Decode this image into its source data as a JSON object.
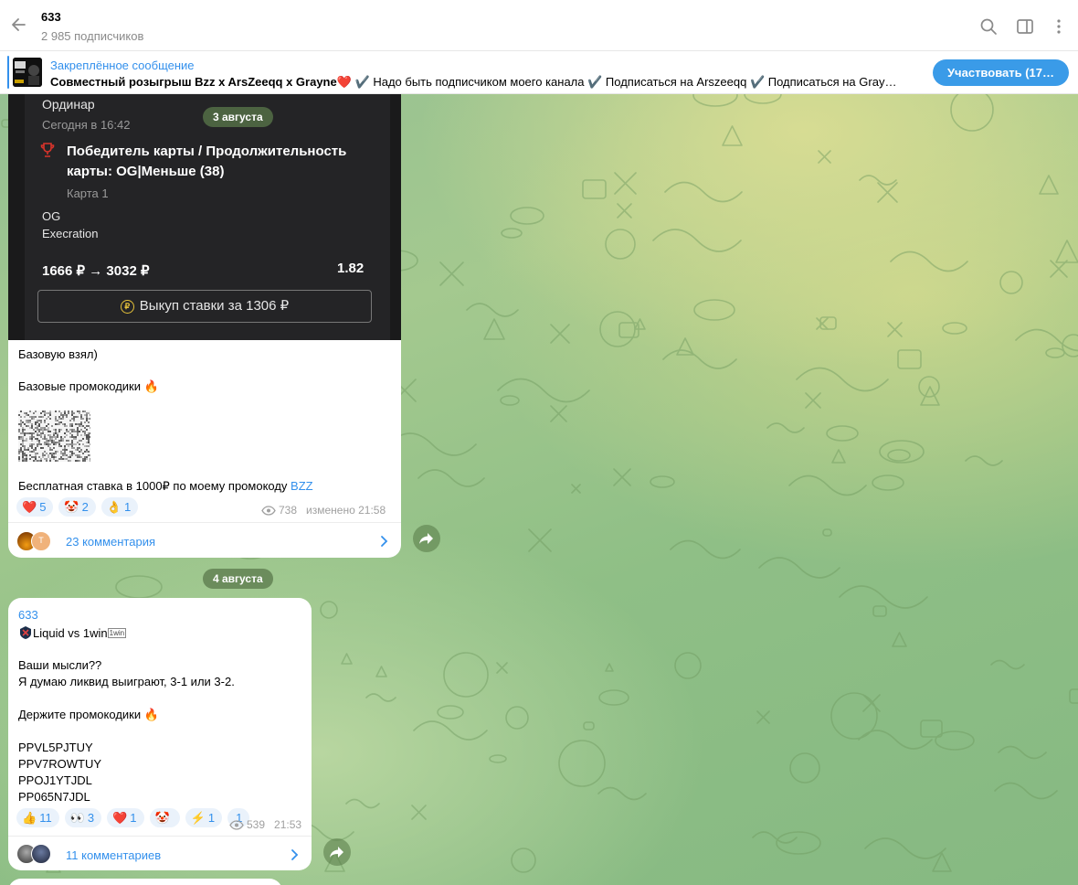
{
  "header": {
    "title": "633",
    "subscribers": "2 985 подписчиков"
  },
  "pinned": {
    "title": "Закреплённое сообщение",
    "text_bold": "Совместный розыгрыш Bzz x ArsZeeqq x Grayne",
    "text_rest": "❤️ ✔️ Надо быть подписчиком моего канала ✔️ Подписаться на Arszeeqq ✔️ Подписаться на Gray…",
    "button": "Участвовать (17…"
  },
  "message1": {
    "date_pill": "3 августа",
    "bet": {
      "type": "Ординар",
      "time": "Сегодня в 16:42",
      "market": "Победитель карты / Продолжительность карты: OG|Меньше (38)",
      "map": "Карта 1",
      "team1": "OG",
      "team2": "Execration",
      "amount": "1666 ₽ → 3032 ₽",
      "coefficient": "1.82",
      "buyout": "Выкуп ставки за 1306 ₽"
    },
    "line1": "Базовую взял)",
    "line2": "Базовые промокодики 🔥",
    "promo_text": "Бесплатная ставка в 1000₽ по моему промокоду ",
    "promo_code": "BZZ",
    "reactions": [
      {
        "emoji": "❤️",
        "count": "5"
      },
      {
        "emoji": "🤡",
        "count": "2"
      },
      {
        "emoji": "👌",
        "count": "1"
      }
    ],
    "views": "738",
    "edited": "изменено 21:58",
    "comments": "23 комментария"
  },
  "date2": "4 августа",
  "message2": {
    "author": "633",
    "title": "Liquid vs 1win",
    "badge": "1win",
    "line1": "Ваши мысли??",
    "line2": "Я думаю ликвид выиграют, 3-1 или 3-2.",
    "line3": "Держите промокодики 🔥",
    "codes": [
      "PPVL5PJTUY",
      "PPV7ROWTUY",
      "PPOJ1YTJDL",
      "PP065N7JDL"
    ],
    "reactions": [
      {
        "emoji": "👍",
        "count": "11"
      },
      {
        "emoji": "👀",
        "count": "3"
      },
      {
        "emoji": "❤️",
        "count": "1"
      },
      {
        "emoji": "🤡",
        "count": ""
      },
      {
        "emoji": "⚡",
        "count": "1"
      },
      {
        "emoji": "",
        "count": "1"
      }
    ],
    "views": "539",
    "time": "21:53",
    "comments": "11 комментариев"
  },
  "colors": {
    "accent": "#3390ec",
    "button": "#3a9be8",
    "bet_card_bg": "#242426"
  },
  "icons": [
    "back-arrow-icon",
    "search-icon",
    "sidebar-toggle-icon",
    "more-vertical-icon",
    "trophy-icon",
    "ruble-coin-icon",
    "eye-icon",
    "chevron-right-icon",
    "share-icon"
  ]
}
